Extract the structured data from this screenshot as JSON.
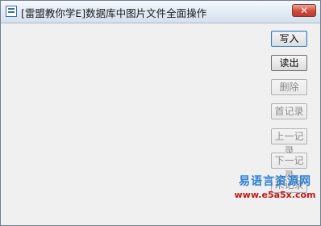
{
  "window": {
    "title": "[雷盟教你学E]数据库中图片文件全面操作",
    "close_label": "✕"
  },
  "buttons": {
    "write": "写入",
    "read": "读出",
    "delete": "删除",
    "first": "首记录",
    "prev": "上一记录",
    "next": "下一记录",
    "last": "末记录"
  },
  "watermark": {
    "title": "易语言资源网",
    "url": "www.e5a5x.com"
  },
  "colors": {
    "close_button": "#c0392b",
    "watermark_title": "#2b7fd4",
    "watermark_url": "#c01818"
  }
}
